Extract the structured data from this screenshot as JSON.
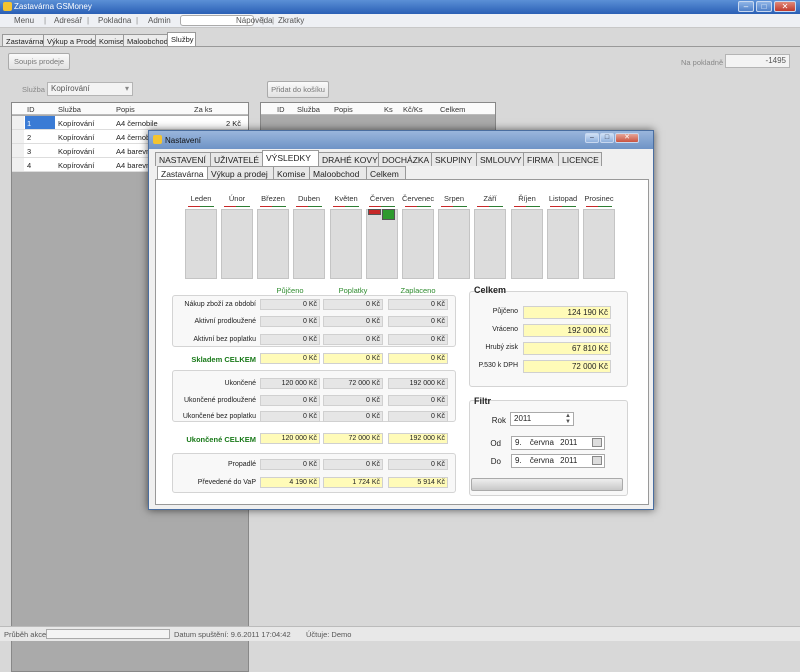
{
  "app": {
    "title": "Zastavárna GSMoney",
    "min": "–",
    "max": "□",
    "close": "✕"
  },
  "menu": [
    "Menu",
    "Adresář",
    "Pokladna",
    "Admin",
    "Nápověda",
    "Zkratky"
  ],
  "main_tabs": [
    "Zastavárna",
    "Výkup a Prodej",
    "Komise",
    "Maloobchod",
    "Služby"
  ],
  "main": {
    "soupis_label": "Soupis prodeje",
    "na_pokladne_label": "Na pokladně",
    "na_pokladne_value": "-1495",
    "sluzba_label": "Služba",
    "sluzba_value": "Kopírování",
    "pridat_label": "Přidat do košíku",
    "left_grid": {
      "headers": [
        "ID",
        "Služba",
        "Popis",
        "Za ks"
      ],
      "rows": [
        [
          "1",
          "Kopírování",
          "A4 černobile",
          "2 Kč"
        ],
        [
          "2",
          "Kopírování",
          "A4 černobíle",
          ""
        ],
        [
          "3",
          "Kopírování",
          "A4 barevně",
          ""
        ],
        [
          "4",
          "Kopírování",
          "A4 barevně",
          ""
        ]
      ]
    },
    "right_grid": {
      "headers": [
        "ID",
        "Služba",
        "Popis",
        "Ks",
        "Kč/Ks",
        "Celkem"
      ]
    }
  },
  "status": {
    "progress_label": "Průběh akce",
    "date_text": "Datum spuštění: 9.6.2011 17:04:42",
    "account_text": "Účtuje: Demo"
  },
  "dialog": {
    "title": "Nastavení",
    "top_tabs": [
      "NASTAVENÍ",
      "UŽIVATELÉ",
      "VÝSLEDKY",
      "DRAHÉ KOVY",
      "DOCHÁZKA",
      "SKUPINY",
      "SMLOUVY",
      "FIRMA",
      "LICENCE"
    ],
    "active_top_tab": 2,
    "sub_tabs": [
      "Zastavárna",
      "Výkup a prodej",
      "Komise",
      "Maloobchod",
      "Celkem"
    ],
    "months": [
      "Leden",
      "Únor",
      "Březen",
      "Duben",
      "Květen",
      "Červen",
      "Červenec",
      "Srpen",
      "Září",
      "Říjen",
      "Listopad",
      "Prosinec"
    ],
    "month_bars": {
      "month": "Červen",
      "red_fraction": 0.14,
      "green_fraction": 0.16,
      "red_color": "#c62828",
      "green_color": "#2e9a2e"
    },
    "col_headers": [
      "Půjčeno",
      "Poplatky",
      "Zaplaceno"
    ],
    "section1": [
      {
        "label": "Nákup zboží za období",
        "v": [
          "0 Kč",
          "0 Kč",
          "0 Kč"
        ]
      },
      {
        "label": "Aktivní prodloužené",
        "v": [
          "0 Kč",
          "0 Kč",
          "0 Kč"
        ]
      },
      {
        "label": "Aktivní bez poplatku",
        "v": [
          "0 Kč",
          "0 Kč",
          "0 Kč"
        ]
      }
    ],
    "skladem": {
      "label": "Skladem CELKEM",
      "v": [
        "0 Kč",
        "0 Kč",
        "0 Kč"
      ]
    },
    "section2": [
      {
        "label": "Ukončené",
        "v": [
          "120 000 Kč",
          "72 000 Kč",
          "192 000 Kč"
        ]
      },
      {
        "label": "Ukončené prodloužené",
        "v": [
          "0 Kč",
          "0 Kč",
          "0 Kč"
        ]
      },
      {
        "label": "Ukončené bez poplatku",
        "v": [
          "0 Kč",
          "0 Kč",
          "0 Kč"
        ]
      }
    ],
    "ukoncene": {
      "label": "Ukončené CELKEM",
      "v": [
        "120 000 Kč",
        "72 000 Kč",
        "192 000 Kč"
      ]
    },
    "section3": [
      {
        "label": "Propadlé",
        "v": [
          "0 Kč",
          "0 Kč",
          "0 Kč"
        ]
      },
      {
        "label": "Převedené do VaP",
        "v": [
          "4 190 Kč",
          "1 724 Kč",
          "5 914 Kč"
        ]
      }
    ],
    "celkem": {
      "title": "Celkem",
      "rows": [
        {
          "label": "Půjčeno",
          "value": "124 190 Kč"
        },
        {
          "label": "Vráceno",
          "value": "192 000 Kč"
        },
        {
          "label": "Hrubý zisk",
          "value": "67 810 Kč"
        },
        {
          "label": "P.530 k DPH",
          "value": "72 000 Kč"
        }
      ]
    },
    "filtr": {
      "title": "Filtr",
      "rok_label": "Rok",
      "rok_value": "2011",
      "od_label": "Od",
      "od_day": "9.",
      "od_month": "června",
      "od_year": "2011",
      "do_label": "Do",
      "do_day": "9.",
      "do_month": "června",
      "do_year": "2011"
    }
  }
}
